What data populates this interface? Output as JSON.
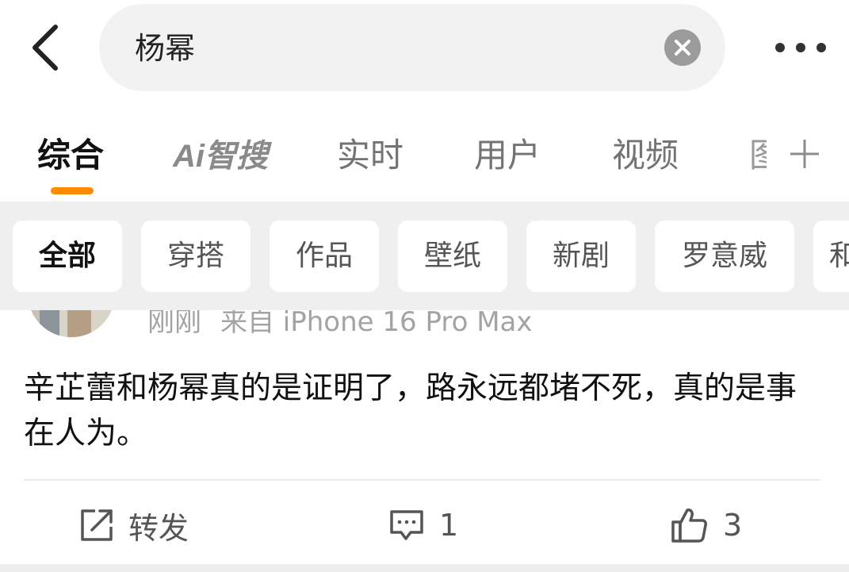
{
  "search": {
    "query": "杨幂"
  },
  "tabs": [
    {
      "label": "综合"
    },
    {
      "label": "Ai智搜"
    },
    {
      "label": "实时"
    },
    {
      "label": "用户"
    },
    {
      "label": "视频"
    },
    {
      "label": "图"
    }
  ],
  "chips": [
    {
      "label": "全部"
    },
    {
      "label": "穿搭"
    },
    {
      "label": "作品"
    },
    {
      "label": "壁纸"
    },
    {
      "label": "新剧"
    },
    {
      "label": "罗意威"
    },
    {
      "label": "和"
    }
  ],
  "post": {
    "time": "刚刚",
    "source": "来自 iPhone 16 Pro Max",
    "content": "辛芷蕾和杨幂真的是证明了，路永远都堵不死，真的是事在人为。"
  },
  "actions": {
    "repost_label": "转发",
    "comment_count": "1",
    "like_count": "3"
  },
  "colors": {
    "accent": "#ff8c00",
    "chip_bar_bg": "#efefef",
    "search_bg": "#f2f2f2"
  }
}
